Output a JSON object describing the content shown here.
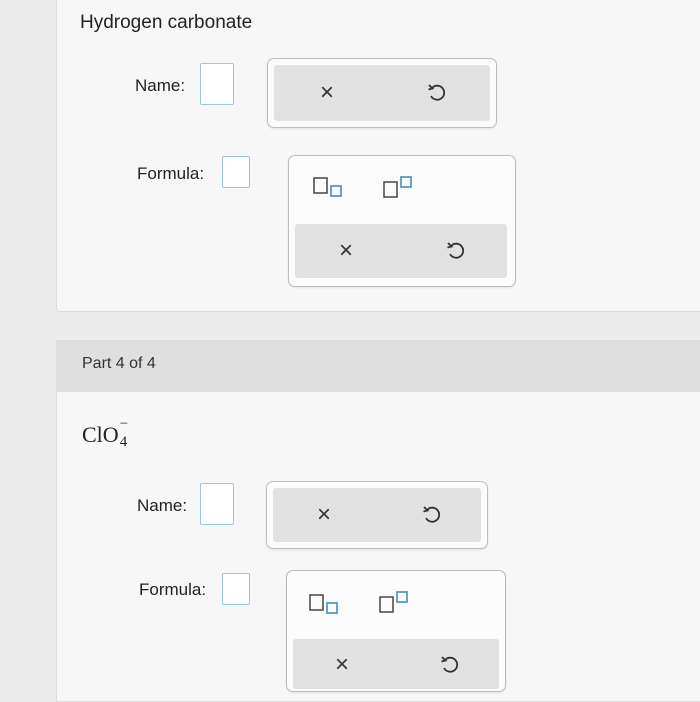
{
  "part3": {
    "heading": "Hydrogen carbonate",
    "name_label": "Name:",
    "formula_label": "Formula:",
    "clear_symbol": "×"
  },
  "part4": {
    "header": "Part 4 of 4",
    "ion": {
      "symbol": "ClO",
      "subscript": "4",
      "charge": "−"
    },
    "name_label": "Name:",
    "formula_label": "Formula:",
    "clear_symbol": "×"
  },
  "icons": {
    "undo": "undo-icon",
    "subscript": "subscript-template-icon",
    "superscript": "superscript-template-icon",
    "clear": "clear-x-icon"
  },
  "colors": {
    "input_border": "#9ec5d6",
    "input_inner_square": "#5a9bb8",
    "panel_bg": "#f7f7f7",
    "header_bg": "#dfdfdf"
  }
}
